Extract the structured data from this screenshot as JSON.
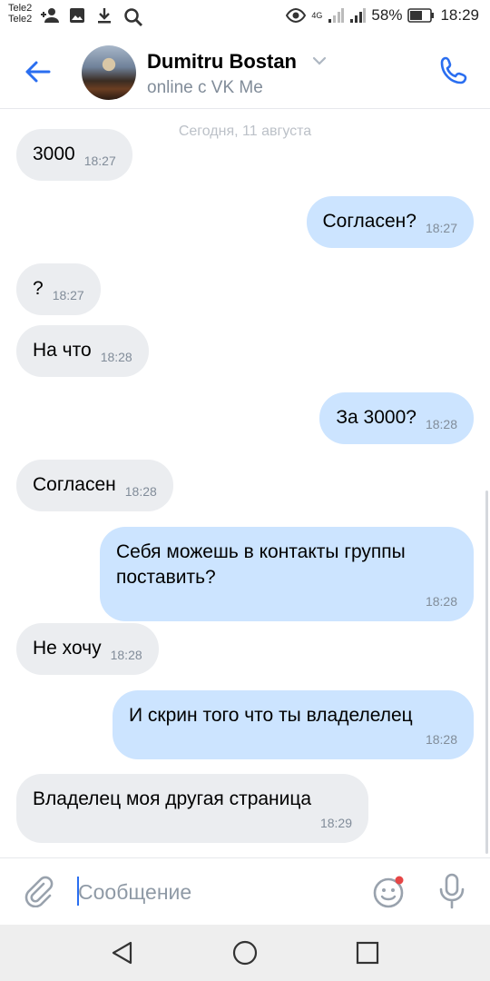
{
  "status_bar": {
    "carrier_1": "Tele2",
    "carrier_2": "Tele2",
    "network": "4G",
    "battery": "58%",
    "time": "18:29"
  },
  "header": {
    "contact_name": "Dumitru Bostan",
    "presence": "online с VK Me"
  },
  "chat": {
    "date_separator": "Сегодня, 11 августа",
    "messages": [
      {
        "dir": "in",
        "text": "3000",
        "time": "18:27"
      },
      {
        "dir": "out",
        "text": "Согласен?",
        "time": "18:27"
      },
      {
        "dir": "in",
        "text": "?",
        "time": "18:27"
      },
      {
        "dir": "in",
        "text": "На что",
        "time": "18:28"
      },
      {
        "dir": "out",
        "text": "За 3000?",
        "time": "18:28"
      },
      {
        "dir": "in",
        "text": "Согласен",
        "time": "18:28"
      },
      {
        "dir": "out",
        "text": "Себя можешь в контакты группы поставить?",
        "time": "18:28"
      },
      {
        "dir": "in",
        "text": "Не хочу",
        "time": "18:28"
      },
      {
        "dir": "out",
        "text": "И скрин того что ты владелелец",
        "time": "18:28"
      },
      {
        "dir": "in",
        "text": "Владелец моя другая страница",
        "time": "18:29"
      }
    ]
  },
  "composer": {
    "placeholder": "Сообщение",
    "value": ""
  },
  "colors": {
    "accent": "#2a6ef0",
    "incoming_bubble": "#ebedf0",
    "outgoing_bubble": "#cce4ff",
    "secondary_text": "#818c99"
  },
  "icons": [
    "back-arrow-icon",
    "chevron-down-icon",
    "phone-icon",
    "attach-icon",
    "emoji-icon",
    "mic-icon",
    "nav-back-icon",
    "nav-home-icon",
    "nav-recents-icon"
  ]
}
